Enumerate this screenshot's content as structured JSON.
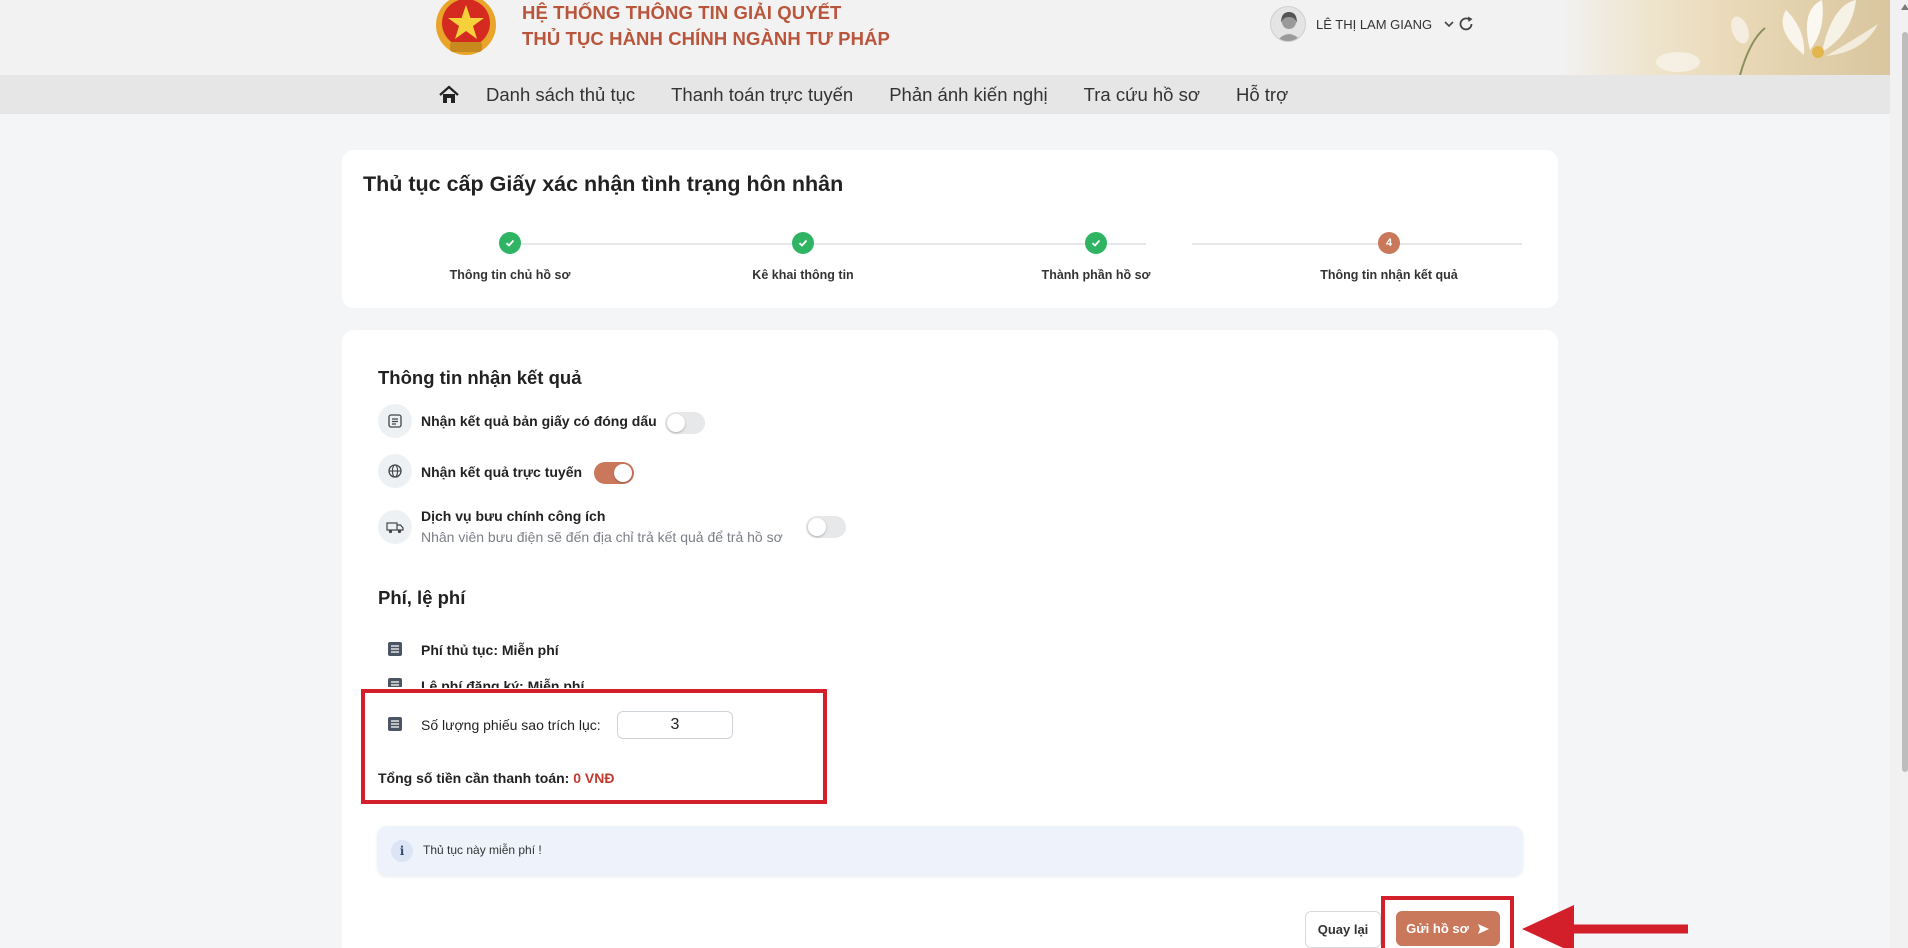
{
  "header": {
    "title_line1": "HỆ THỐNG THÔNG TIN GIẢI QUYẾT",
    "title_line2": "THỦ TỤC HÀNH CHÍNH NGÀNH TƯ PHÁP",
    "user_name": "LÊ THỊ LAM GIANG",
    "icons": [
      "national-emblem",
      "avatar",
      "chevron-down-icon",
      "refresh-icon"
    ]
  },
  "nav": {
    "items": [
      {
        "label": "Danh sách thủ tục"
      },
      {
        "label": "Thanh toán trực tuyến"
      },
      {
        "label": "Phản ánh kiến nghị"
      },
      {
        "label": "Tra cứu hồ sơ"
      },
      {
        "label": "Hỗ trợ"
      }
    ]
  },
  "page": {
    "title": "Thủ tục cấp Giấy xác nhận tình trạng hôn nhân"
  },
  "steps": [
    {
      "label": "Thông tin chủ hồ sơ",
      "status": "done"
    },
    {
      "label": "Kê khai thông tin",
      "status": "done"
    },
    {
      "label": "Thành phần hồ sơ",
      "status": "done"
    },
    {
      "label": "Thông tin nhận kết quả",
      "status": "active",
      "number": "4"
    }
  ],
  "receive": {
    "section_title": "Thông tin nhận kết quả",
    "options": [
      {
        "label": "Nhận kết quả bản giấy có đóng dấu",
        "enabled": false,
        "icon": "document-icon"
      },
      {
        "label": "Nhận kết quả trực tuyến",
        "enabled": true,
        "icon": "globe-icon"
      },
      {
        "label": "Dịch vụ bưu chính công ích",
        "sub": "Nhân viên bưu điện sẽ đến địa chỉ trả kết quả để trả hồ sơ",
        "enabled": false,
        "icon": "delivery-truck-icon"
      }
    ]
  },
  "fees": {
    "section_title": "Phí, lệ phí",
    "items": [
      {
        "text": "Phí thủ tục: Miễn phí"
      },
      {
        "text": "Lệ phí đăng ký: Miễn phí"
      }
    ],
    "quantity_label": "Số lượng phiếu sao trích lục:",
    "quantity_value": "3",
    "total_label": "Tổng số tiền cần thanh toán:",
    "total_amount": "0 VNĐ"
  },
  "info": {
    "icon_glyph": "i",
    "text": "Thủ tục này miễn phí !"
  },
  "actions": {
    "back_label": "Quay lại",
    "send_label": "Gửi hồ sơ"
  },
  "colors": {
    "brand": "#b9553b",
    "accent": "#c9785b",
    "success": "#2fb463",
    "annotation": "#d21f2a",
    "total_amount": "#c23b2f"
  }
}
